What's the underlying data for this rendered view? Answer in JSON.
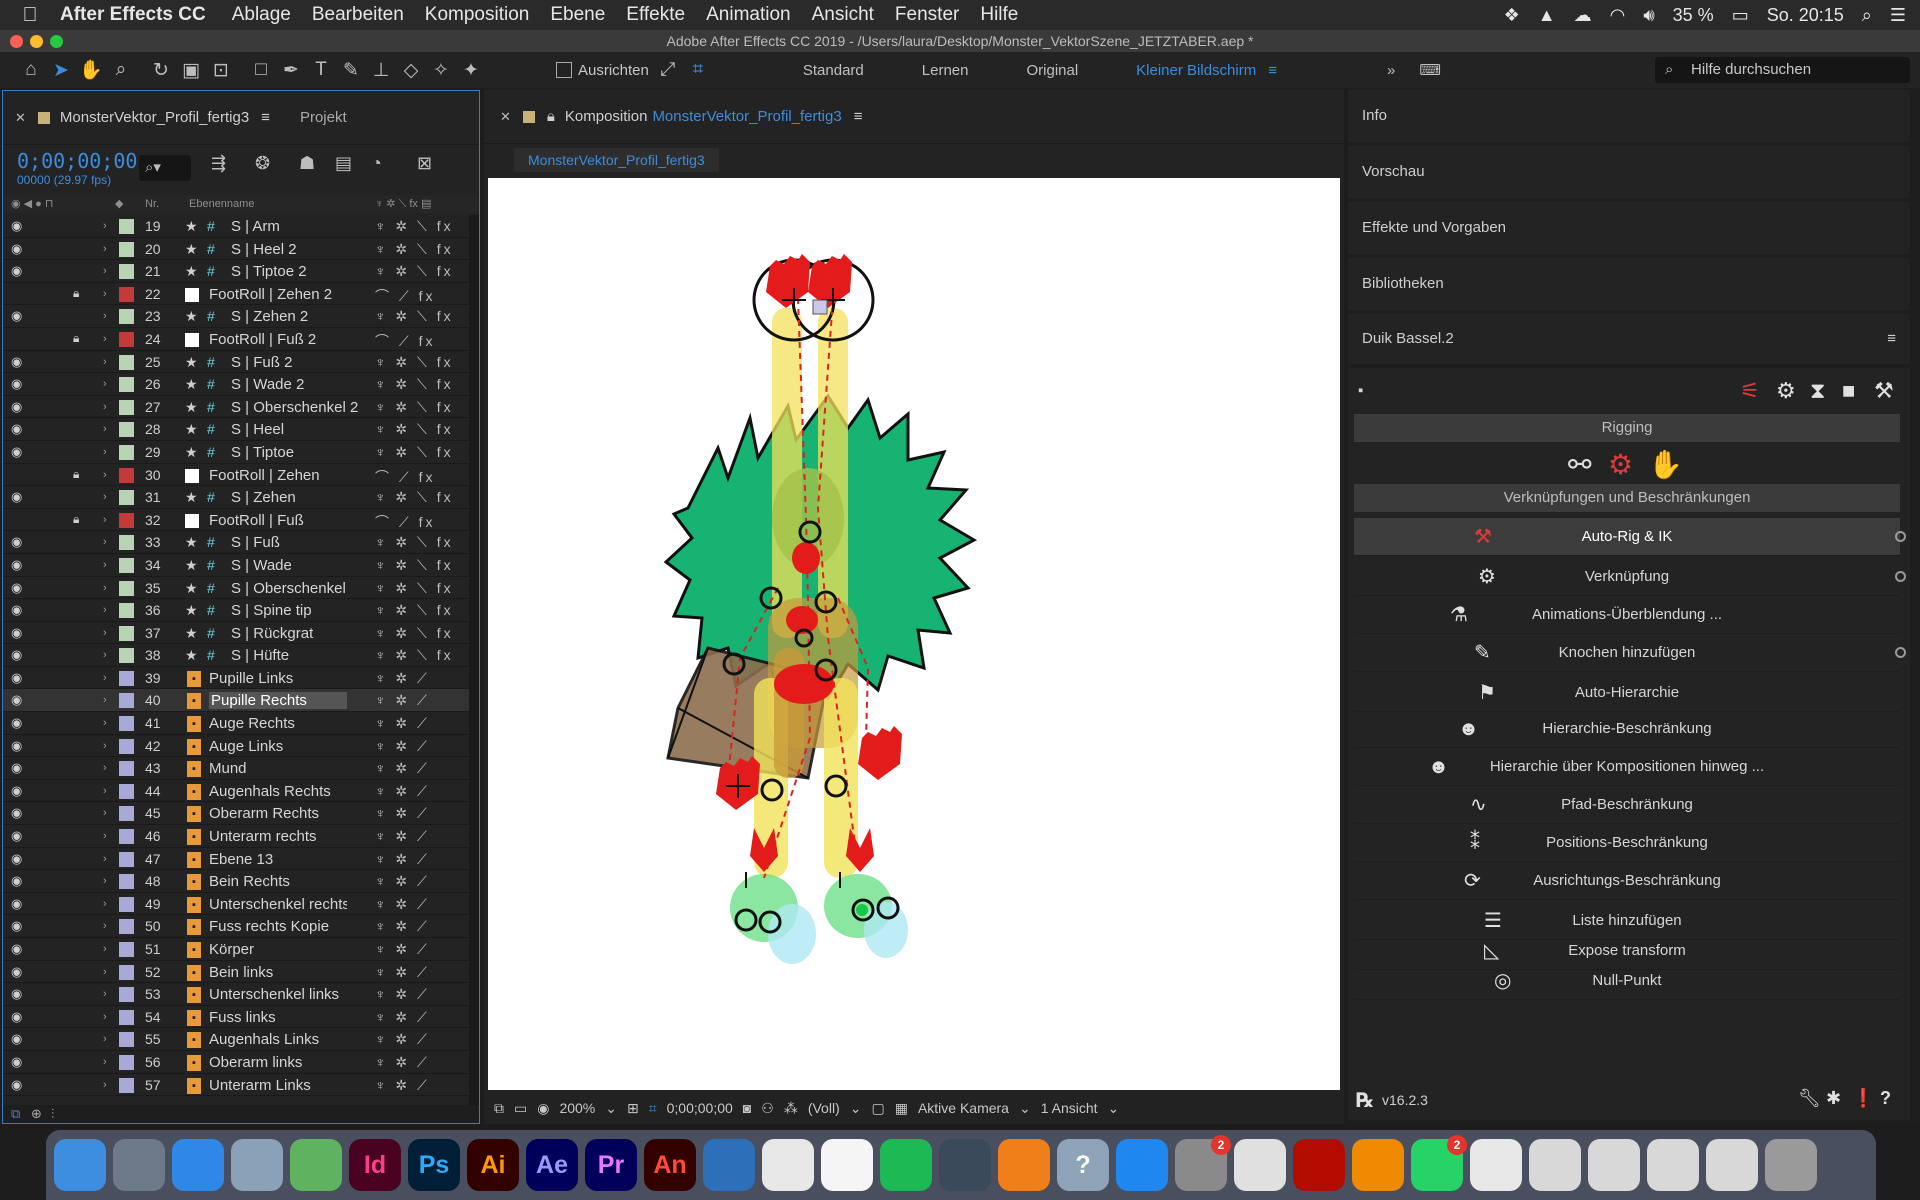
{
  "menubar": {
    "app": "After Effects CC",
    "items": [
      "Ablage",
      "Bearbeiten",
      "Komposition",
      "Ebene",
      "Effekte",
      "Animation",
      "Ansicht",
      "Fenster",
      "Hilfe"
    ],
    "battery": "35 %",
    "clock": "So. 20:15"
  },
  "titlebar": {
    "title": "Adobe After Effects CC 2019 - /Users/laura/Desktop/Monster_VektorSzene_JETZTABER.aep *"
  },
  "toolbar": {
    "align_label": "Ausrichten",
    "workspaces": [
      "Standard",
      "Lernen",
      "Original",
      "Kleiner Bildschirm"
    ],
    "active_workspace": "Kleiner Bildschirm",
    "help_placeholder": "Hilfe durchsuchen"
  },
  "timeline": {
    "tab_comp": "MonsterVektor_Profil_fertig3",
    "tab_project": "Projekt",
    "timecode": "0;00;00;00",
    "fps": "00000 (29.97 fps)",
    "search_glyph": "⌕▾",
    "col_nr": "Nr.",
    "col_name": "Ebenenname",
    "layers": [
      {
        "nr": "19",
        "name": "S | Arm",
        "kind": "shape",
        "color": "#b8d4b4",
        "lock": false
      },
      {
        "nr": "20",
        "name": "S | Heel 2",
        "kind": "shape",
        "color": "#b8d4b4",
        "lock": false
      },
      {
        "nr": "21",
        "name": "S | Tiptoe 2",
        "kind": "shape",
        "color": "#b8d4b4",
        "lock": false
      },
      {
        "nr": "22",
        "name": "FootRoll | Zehen 2",
        "kind": "solid",
        "color": "#c43a3a",
        "lock": true
      },
      {
        "nr": "23",
        "name": "S | Zehen 2",
        "kind": "shape",
        "color": "#b8d4b4",
        "lock": false
      },
      {
        "nr": "24",
        "name": "FootRoll | Fuß 2",
        "kind": "solid",
        "color": "#c43a3a",
        "lock": true
      },
      {
        "nr": "25",
        "name": "S | Fuß 2",
        "kind": "shape",
        "color": "#b8d4b4",
        "lock": false
      },
      {
        "nr": "26",
        "name": "S | Wade 2",
        "kind": "shape",
        "color": "#b8d4b4",
        "lock": false
      },
      {
        "nr": "27",
        "name": "S | Oberschenkel 2",
        "kind": "shape",
        "color": "#b8d4b4",
        "lock": false
      },
      {
        "nr": "28",
        "name": "S | Heel",
        "kind": "shape",
        "color": "#b8d4b4",
        "lock": false
      },
      {
        "nr": "29",
        "name": "S | Tiptoe",
        "kind": "shape",
        "color": "#b8d4b4",
        "lock": false
      },
      {
        "nr": "30",
        "name": "FootRoll | Zehen",
        "kind": "solid",
        "color": "#c43a3a",
        "lock": true
      },
      {
        "nr": "31",
        "name": "S | Zehen",
        "kind": "shape",
        "color": "#b8d4b4",
        "lock": false
      },
      {
        "nr": "32",
        "name": "FootRoll | Fuß",
        "kind": "solid",
        "color": "#c43a3a",
        "lock": true
      },
      {
        "nr": "33",
        "name": "S | Fuß",
        "kind": "shape",
        "color": "#b8d4b4",
        "lock": false
      },
      {
        "nr": "34",
        "name": "S | Wade",
        "kind": "shape",
        "color": "#b8d4b4",
        "lock": false
      },
      {
        "nr": "35",
        "name": "S | Oberschenkel",
        "kind": "shape",
        "color": "#b8d4b4",
        "lock": false
      },
      {
        "nr": "36",
        "name": "S | Spine tip",
        "kind": "shape",
        "color": "#b8d4b4",
        "lock": false
      },
      {
        "nr": "37",
        "name": "S | Rückgrat",
        "kind": "shape",
        "color": "#b8d4b4",
        "lock": false
      },
      {
        "nr": "38",
        "name": "S | Hüfte",
        "kind": "shape",
        "color": "#b8d4b4",
        "lock": false
      },
      {
        "nr": "39",
        "name": "Pupille Links",
        "kind": "ai",
        "color": "#a9a9d8",
        "lock": false
      },
      {
        "nr": "40",
        "name": "Pupille Rechts",
        "kind": "ai",
        "color": "#a9a9d8",
        "lock": false,
        "selected": true
      },
      {
        "nr": "41",
        "name": "Auge Rechts",
        "kind": "ai",
        "color": "#a9a9d8",
        "lock": false
      },
      {
        "nr": "42",
        "name": "Auge Links",
        "kind": "ai",
        "color": "#a9a9d8",
        "lock": false
      },
      {
        "nr": "43",
        "name": "Mund",
        "kind": "ai",
        "color": "#a9a9d8",
        "lock": false
      },
      {
        "nr": "44",
        "name": "Augenhals Rechts",
        "kind": "ai",
        "color": "#a9a9d8",
        "lock": false
      },
      {
        "nr": "45",
        "name": "Oberarm Rechts",
        "kind": "ai",
        "color": "#a9a9d8",
        "lock": false
      },
      {
        "nr": "46",
        "name": "Unterarm rechts",
        "kind": "ai",
        "color": "#a9a9d8",
        "lock": false
      },
      {
        "nr": "47",
        "name": "Ebene 13",
        "kind": "ai",
        "color": "#a9a9d8",
        "lock": false
      },
      {
        "nr": "48",
        "name": "Bein Rechts",
        "kind": "ai",
        "color": "#a9a9d8",
        "lock": false
      },
      {
        "nr": "49",
        "name": "Unterschenkel rechts",
        "kind": "ai",
        "color": "#a9a9d8",
        "lock": false
      },
      {
        "nr": "50",
        "name": "Fuss rechts Kopie",
        "kind": "ai",
        "color": "#a9a9d8",
        "lock": false
      },
      {
        "nr": "51",
        "name": "Körper",
        "kind": "ai",
        "color": "#a9a9d8",
        "lock": false
      },
      {
        "nr": "52",
        "name": "Bein links",
        "kind": "ai",
        "color": "#a9a9d8",
        "lock": false
      },
      {
        "nr": "53",
        "name": "Unterschenkel links",
        "kind": "ai",
        "color": "#a9a9d8",
        "lock": false
      },
      {
        "nr": "54",
        "name": "Fuss links",
        "kind": "ai",
        "color": "#a9a9d8",
        "lock": false
      },
      {
        "nr": "55",
        "name": "Augenhals Links",
        "kind": "ai",
        "color": "#a9a9d8",
        "lock": false
      },
      {
        "nr": "56",
        "name": "Oberarm links",
        "kind": "ai",
        "color": "#a9a9d8",
        "lock": false
      },
      {
        "nr": "57",
        "name": "Unterarm Links",
        "kind": "ai",
        "color": "#a9a9d8",
        "lock": false
      }
    ]
  },
  "comp": {
    "tab_prefix": "Komposition",
    "tab_name": "MonsterVektor_Profil_fertig3",
    "subtab": "MonsterVektor_Profil_fertig3",
    "zoom": "200%",
    "timecode": "0;00;00;00",
    "quality": "(Voll)",
    "camera": "Aktive Kamera",
    "views": "1 Ansicht"
  },
  "right": {
    "panels": [
      "Info",
      "Vorschau",
      "Effekte und Vorgaben",
      "Bibliotheken"
    ],
    "duik_title": "Duik Bassel.2",
    "section_rigging": "Rigging",
    "section_links": "Verknüpfungen und Beschränkungen",
    "buttons": [
      {
        "label": "Auto-Rig & IK",
        "icon": "auto-rig-icon"
      },
      {
        "label": "Verknüpfung",
        "icon": "link-icon"
      },
      {
        "label": "Animations-Überblendung ...",
        "icon": "blend-icon"
      },
      {
        "label": "Knochen hinzufügen",
        "icon": "bone-icon"
      },
      {
        "label": "Auto-Hierarchie",
        "icon": "hierarchy-icon"
      },
      {
        "label": "Hierarchie-Beschränkung",
        "icon": "hierarchy-constraint-icon"
      },
      {
        "label": "Hierarchie über Kompositionen hinweg ...",
        "icon": "cross-comp-icon"
      },
      {
        "label": "Pfad-Beschränkung",
        "icon": "path-icon"
      },
      {
        "label": "Positions-Beschränkung",
        "icon": "position-icon"
      },
      {
        "label": "Ausrichtungs-Beschränkung",
        "icon": "orient-icon"
      },
      {
        "label": "Liste hinzufügen",
        "icon": "list-icon"
      },
      {
        "label": "Expose transform",
        "icon": "expose-icon"
      },
      {
        "label": "Null-Punkt",
        "icon": "null-icon"
      }
    ],
    "version": "v16.2.3"
  },
  "dock": [
    {
      "label": "",
      "bg": "#3d8ee0",
      "icon": "finder-icon"
    },
    {
      "label": "",
      "bg": "#6c7a8a",
      "icon": "launchpad-icon"
    },
    {
      "label": "",
      "bg": "#2f87e6",
      "icon": "safari-icon"
    },
    {
      "label": "",
      "bg": "#8aa2b8",
      "icon": "preview-icon"
    },
    {
      "label": "",
      "bg": "#5fb25f",
      "icon": "maps-icon"
    },
    {
      "label": "Id",
      "bg": "#49021f",
      "fg": "#ff3c8c",
      "icon": "indesign-icon"
    },
    {
      "label": "Ps",
      "bg": "#001e36",
      "fg": "#31a8ff",
      "icon": "photoshop-icon"
    },
    {
      "label": "Ai",
      "bg": "#330000",
      "fg": "#ff9a00",
      "icon": "illustrator-icon"
    },
    {
      "label": "Ae",
      "bg": "#00005b",
      "fg": "#9999ff",
      "icon": "aftereffects-icon"
    },
    {
      "label": "Pr",
      "bg": "#00005b",
      "fg": "#ea77ff",
      "icon": "premiere-icon"
    },
    {
      "label": "An",
      "bg": "#330000",
      "fg": "#ff4b3a",
      "icon": "animate-icon"
    },
    {
      "label": "",
      "bg": "#2d6fb8",
      "icon": "app-icon"
    },
    {
      "label": "",
      "bg": "#e8e8e8",
      "icon": "textedit-icon"
    },
    {
      "label": "",
      "bg": "#f5f5f5",
      "icon": "photos-icon"
    },
    {
      "label": "",
      "bg": "#1db954",
      "icon": "spotify-icon"
    },
    {
      "label": "",
      "bg": "#3a4a5a",
      "icon": "app-icon"
    },
    {
      "label": "",
      "bg": "#f07f1a",
      "icon": "books-icon"
    },
    {
      "label": "?",
      "bg": "#8fa3b8",
      "icon": "help-icon"
    },
    {
      "label": "",
      "bg": "#1e88f0",
      "icon": "appstore-icon"
    },
    {
      "label": "",
      "bg": "#8a8a8a",
      "icon": "settings-icon",
      "badge": "2"
    },
    {
      "label": "",
      "bg": "#e0e0e0",
      "icon": "chrome-icon"
    },
    {
      "label": "",
      "bg": "#b30b00",
      "icon": "acrobat-icon"
    },
    {
      "label": "",
      "bg": "#f08a00",
      "icon": "vlc-icon"
    },
    {
      "label": "",
      "bg": "#25d366",
      "icon": "whatsapp-icon",
      "badge": "2"
    },
    {
      "label": "",
      "bg": "#e8e8e8",
      "icon": "numbers-icon"
    },
    {
      "label": "",
      "bg": "#d8d8d8",
      "icon": "window-icon"
    },
    {
      "label": "",
      "bg": "#d8d8d8",
      "icon": "window-icon"
    },
    {
      "label": "",
      "bg": "#d8d8d8",
      "icon": "window-icon"
    },
    {
      "label": "",
      "bg": "#d8d8d8",
      "icon": "window-icon"
    },
    {
      "label": "",
      "bg": "#9a9a9a",
      "icon": "trash-icon"
    }
  ]
}
